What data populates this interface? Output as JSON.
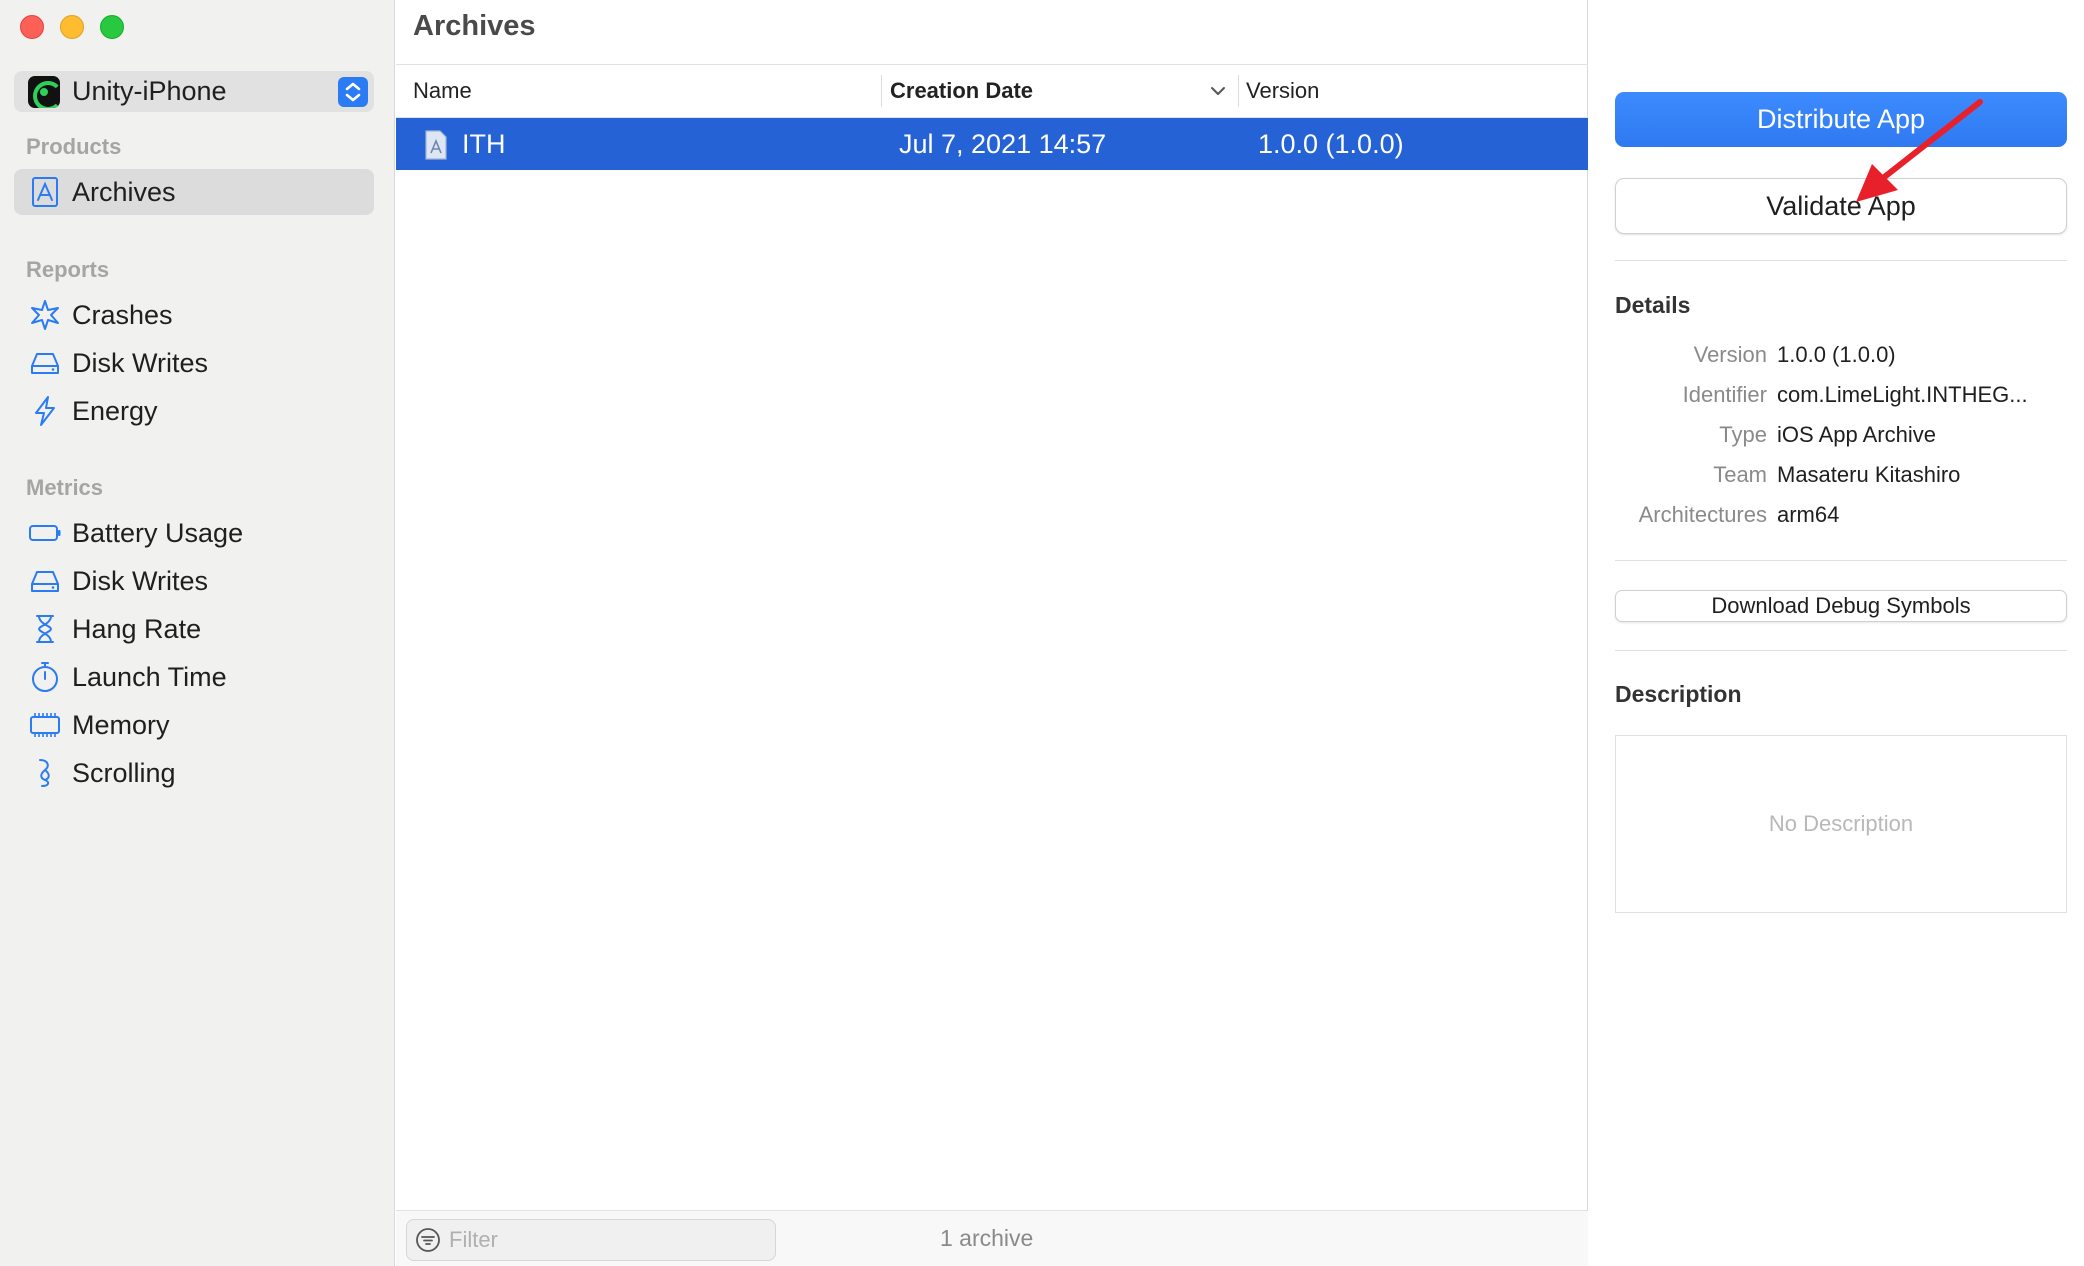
{
  "window": {
    "title": "Archives"
  },
  "sidebar": {
    "scheme": "Unity-iPhone",
    "products_title": "Products",
    "products": [
      {
        "label": "Archives",
        "icon": "archive-icon",
        "selected": true
      }
    ],
    "reports_title": "Reports",
    "reports": [
      {
        "label": "Crashes",
        "icon": "crash-icon"
      },
      {
        "label": "Disk Writes",
        "icon": "disk-icon"
      },
      {
        "label": "Energy",
        "icon": "bolt-icon"
      }
    ],
    "metrics_title": "Metrics",
    "metrics": [
      {
        "label": "Battery Usage",
        "icon": "battery-icon"
      },
      {
        "label": "Disk Writes",
        "icon": "disk-icon"
      },
      {
        "label": "Hang Rate",
        "icon": "hourglass-icon"
      },
      {
        "label": "Launch Time",
        "icon": "stopwatch-icon"
      },
      {
        "label": "Memory",
        "icon": "memory-chip-icon"
      },
      {
        "label": "Scrolling",
        "icon": "scroll-icon"
      }
    ]
  },
  "table": {
    "columns": {
      "name": "Name",
      "date": "Creation Date",
      "version": "Version"
    },
    "rows": [
      {
        "name": "ITH",
        "date": "Jul 7, 2021 14:57",
        "version": "1.0.0 (1.0.0)",
        "selected": true
      }
    ]
  },
  "footer": {
    "filter_placeholder": "Filter",
    "count": "1 archive"
  },
  "inspector": {
    "distribute_label": "Distribute App",
    "validate_label": "Validate App",
    "details_title": "Details",
    "details": [
      {
        "key": "Version",
        "value": "1.0.0 (1.0.0)"
      },
      {
        "key": "Identifier",
        "value": "com.LimeLight.INTHEG..."
      },
      {
        "key": "Type",
        "value": "iOS App Archive"
      },
      {
        "key": "Team",
        "value": "Masateru Kitashiro"
      },
      {
        "key": "Architectures",
        "value": "arm64"
      }
    ],
    "debug_symbols_label": "Download Debug Symbols",
    "description_title": "Description",
    "description_placeholder": "No Description"
  },
  "colors": {
    "accent": "#2f79f0",
    "selection": "#2462d6",
    "annotation_arrow": "#e8202a"
  }
}
